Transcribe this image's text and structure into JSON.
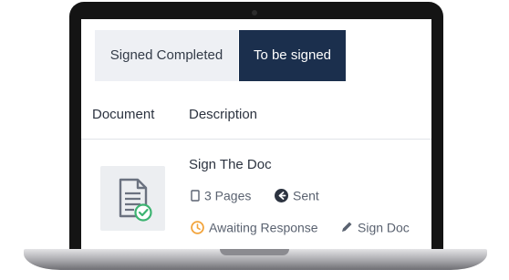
{
  "tabs": {
    "completed": "Signed Completed",
    "to_be_signed": "To be signed"
  },
  "table": {
    "columns": [
      "Document",
      "Description"
    ]
  },
  "document": {
    "title": "Sign The Doc",
    "pages": "3 Pages",
    "sent": "Sent",
    "status": "Awaiting Response",
    "action": "Sign Doc"
  },
  "colors": {
    "active_tab": "#1b2f4d",
    "inactive_tab": "#eef0f4",
    "check": "#3cb371",
    "clock": "#f2a33a"
  },
  "icons": [
    "document-icon",
    "page-icon",
    "sent-icon",
    "clock-icon",
    "pencil-icon"
  ]
}
